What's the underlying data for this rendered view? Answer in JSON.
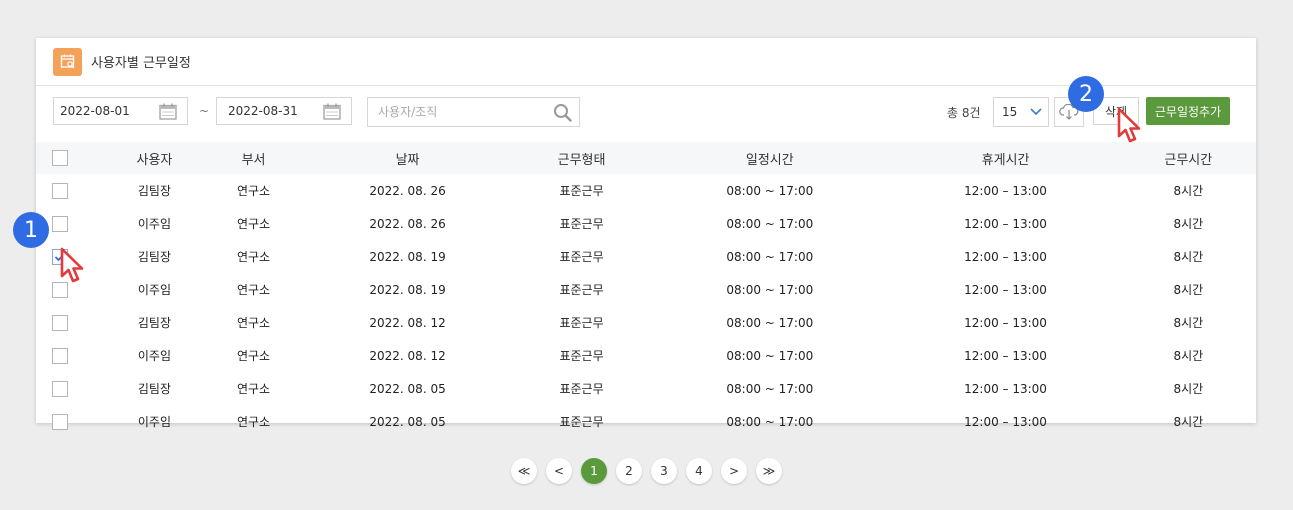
{
  "header": {
    "title": "사용자별 근무일정",
    "icon": "calendar-search-icon"
  },
  "toolbar": {
    "date_from": "2022-08-01",
    "range_sep": "~",
    "date_to": "2022-08-31",
    "search_placeholder": "사용자/조직",
    "total_label": "총 8건",
    "page_size": "15",
    "delete_label": "삭제",
    "add_label": "근무일정추가"
  },
  "table": {
    "columns": [
      "사용자",
      "부서",
      "날짜",
      "근무형태",
      "일정시간",
      "휴게시간",
      "근무시간"
    ],
    "rows": [
      {
        "checked": false,
        "cells": [
          "김팀장",
          "연구소",
          "2022. 08. 26",
          "표준근무",
          "08:00 ~ 17:00",
          "12:00 – 13:00",
          "8시간"
        ]
      },
      {
        "checked": false,
        "cells": [
          "이주임",
          "연구소",
          "2022. 08. 26",
          "표준근무",
          "08:00 ~ 17:00",
          "12:00 – 13:00",
          "8시간"
        ]
      },
      {
        "checked": true,
        "cells": [
          "김팀장",
          "연구소",
          "2022. 08. 19",
          "표준근무",
          "08:00 ~ 17:00",
          "12:00 – 13:00",
          "8시간"
        ]
      },
      {
        "checked": false,
        "cells": [
          "이주임",
          "연구소",
          "2022. 08. 19",
          "표준근무",
          "08:00 ~ 17:00",
          "12:00 – 13:00",
          "8시간"
        ]
      },
      {
        "checked": false,
        "cells": [
          "김팀장",
          "연구소",
          "2022. 08. 12",
          "표준근무",
          "08:00 ~ 17:00",
          "12:00 – 13:00",
          "8시간"
        ]
      },
      {
        "checked": false,
        "cells": [
          "이주임",
          "연구소",
          "2022. 08. 12",
          "표준근무",
          "08:00 ~ 17:00",
          "12:00 – 13:00",
          "8시간"
        ]
      },
      {
        "checked": false,
        "cells": [
          "김팀장",
          "연구소",
          "2022. 08. 05",
          "표준근무",
          "08:00 ~ 17:00",
          "12:00 – 13:00",
          "8시간"
        ]
      },
      {
        "checked": false,
        "cells": [
          "이주임",
          "연구소",
          "2022. 08. 05",
          "표준근무",
          "08:00 ~ 17:00",
          "12:00 – 13:00",
          "8시간"
        ]
      }
    ]
  },
  "annotations": {
    "step1": "1",
    "step2": "2"
  },
  "pagination": {
    "first": "≪",
    "prev": "<",
    "next": ">",
    "last": "≫",
    "pages": [
      "1",
      "2",
      "3",
      "4"
    ],
    "current": "1"
  },
  "colors": {
    "accent_green": "#5a9a3c",
    "badge_blue": "#2f6be3",
    "header_icon_orange": "#f4a259"
  }
}
